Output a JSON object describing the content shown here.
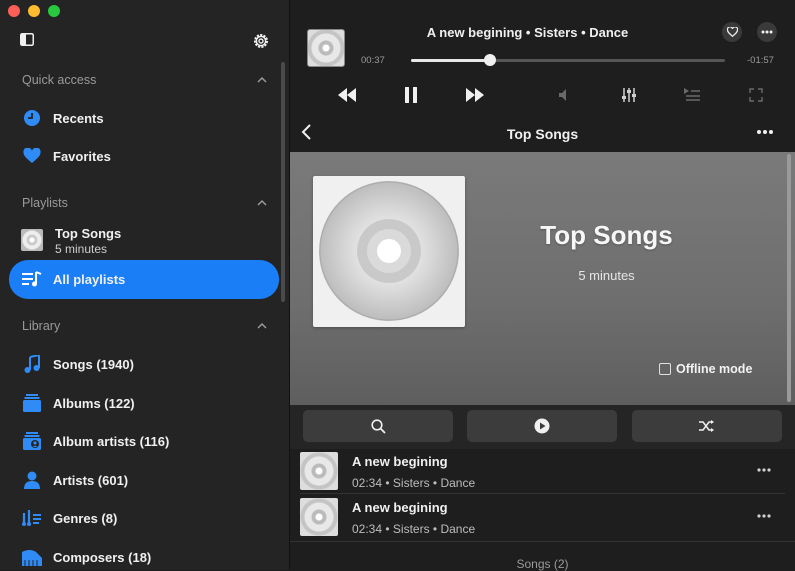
{
  "sidebar": {
    "quick_access": {
      "heading": "Quick access",
      "items": [
        {
          "label": "Recents",
          "icon": "clock-icon"
        },
        {
          "label": "Favorites",
          "icon": "heart-icon"
        }
      ]
    },
    "playlists": {
      "heading": "Playlists",
      "playlist": {
        "title": "Top Songs",
        "subtitle": "5 minutes"
      },
      "all_label": "All playlists"
    },
    "library": {
      "heading": "Library",
      "items": [
        {
          "label": "Songs (1940)",
          "icon": "music-note-icon"
        },
        {
          "label": "Albums (122)",
          "icon": "albums-icon"
        },
        {
          "label": "Album artists (116)",
          "icon": "album-artists-icon"
        },
        {
          "label": "Artists (601)",
          "icon": "artist-icon"
        },
        {
          "label": "Genres (8)",
          "icon": "genres-icon"
        },
        {
          "label": "Composers (18)",
          "icon": "composers-icon"
        }
      ]
    }
  },
  "player": {
    "now_playing": "A new begining • Sisters • Dance",
    "elapsed": "00:37",
    "remaining": "-01:57",
    "progress_fraction": 0.25
  },
  "nav": {
    "title": "Top Songs"
  },
  "hero": {
    "title": "Top Songs",
    "subtitle": "5 minutes",
    "offline_label": "Offline mode",
    "offline_checked": false
  },
  "tracks": [
    {
      "title": "A new begining",
      "meta": "02:34 • Sisters • Dance"
    },
    {
      "title": "A new begining",
      "meta": "02:34 • Sisters • Dance"
    }
  ],
  "footer": {
    "songs_count": "Songs (2)"
  },
  "colors": {
    "accent": "#1a7ff6",
    "icon_blue": "#2f8cf6"
  }
}
